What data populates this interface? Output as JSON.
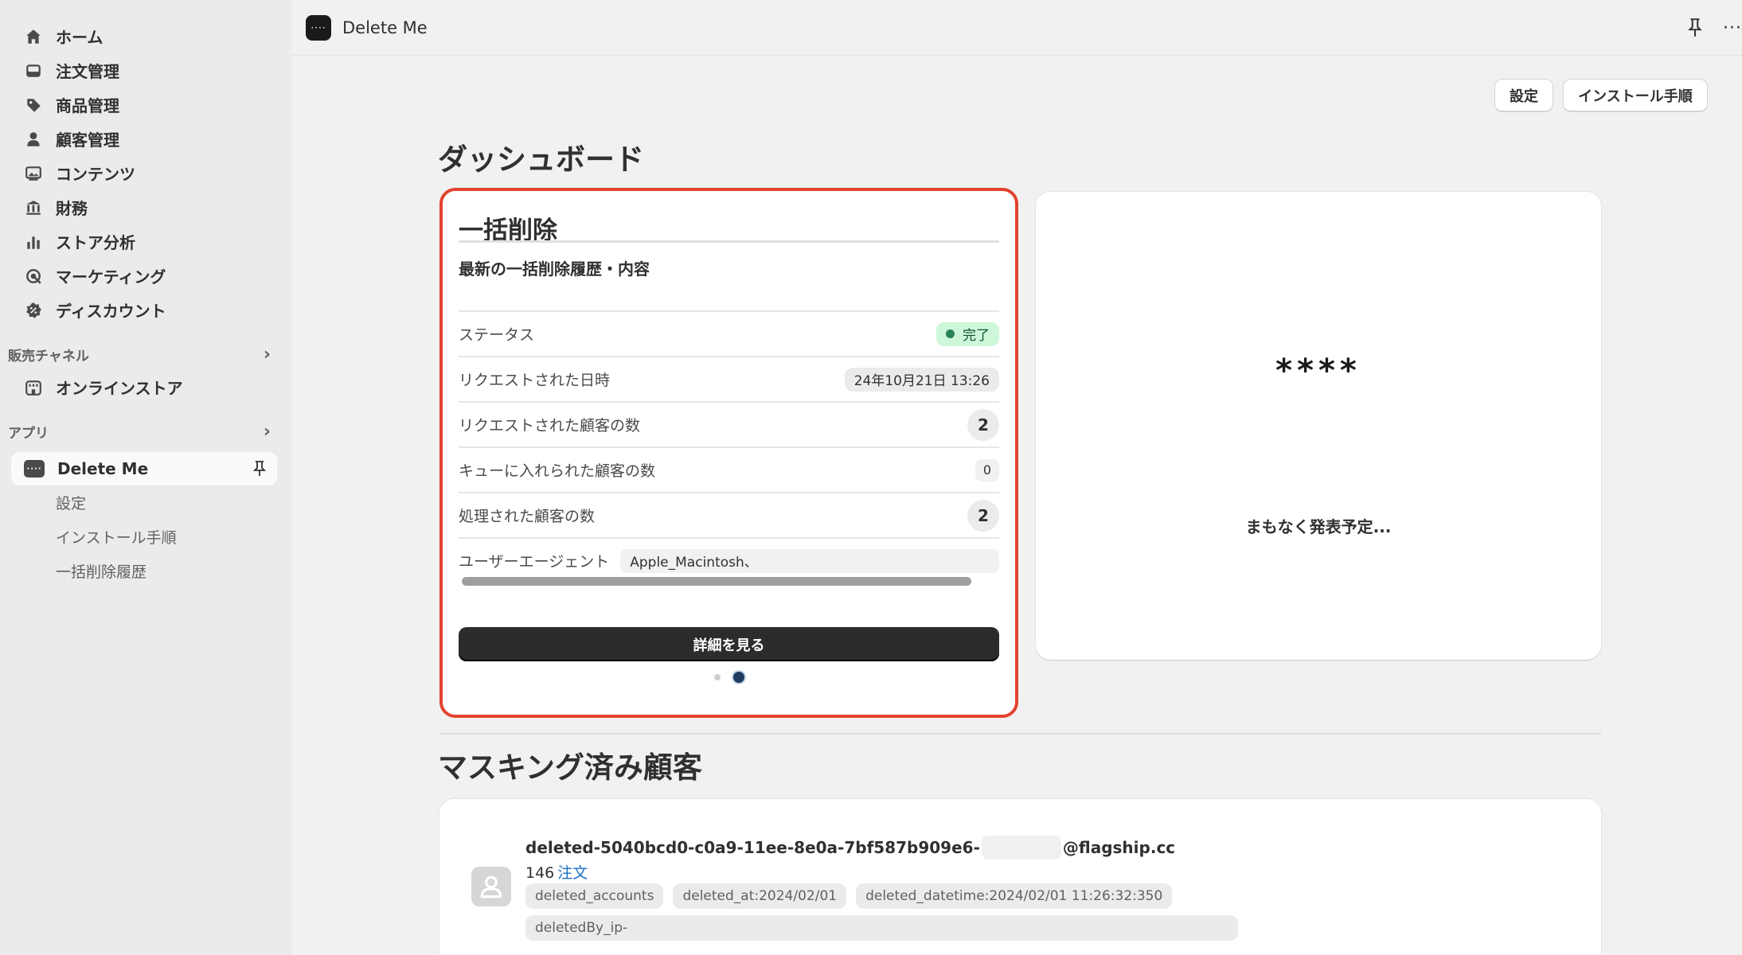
{
  "sidebar": {
    "items": [
      {
        "label": "ホーム",
        "icon": "home-icon"
      },
      {
        "label": "注文管理",
        "icon": "inbox-icon"
      },
      {
        "label": "商品管理",
        "icon": "tag-icon"
      },
      {
        "label": "顧客管理",
        "icon": "person-icon"
      },
      {
        "label": "コンテンツ",
        "icon": "image-icon"
      },
      {
        "label": "財務",
        "icon": "bank-icon"
      },
      {
        "label": "ストア分析",
        "icon": "bar-chart-icon"
      },
      {
        "label": "マーケティング",
        "icon": "target-icon"
      },
      {
        "label": "ディスカウント",
        "icon": "discount-icon"
      }
    ],
    "sales_channel_heading": "販売チャネル",
    "online_store": "オンラインストア",
    "apps_heading": "アプリ",
    "app_name": "Delete Me",
    "app_sub_items": [
      "設定",
      "インストール手順",
      "一括削除履歴"
    ]
  },
  "topbar": {
    "title": "Delete Me",
    "logo_glyph": "····",
    "more": "···"
  },
  "header": {
    "settings_button": "設定",
    "install_button": "インストール手順"
  },
  "dashboard": {
    "heading": "ダッシュボード"
  },
  "bulk_card": {
    "title": "一括削除",
    "subtitle": "最新の一括削除履歴・内容",
    "status_label": "ステータス",
    "status_value": "完了",
    "status_color": "#cdf7d8",
    "requested_at_label": "リクエストされた日時",
    "requested_at_value": "24年10月21日 13:26",
    "requested_customers_label": "リクエストされた顧客の数",
    "requested_customers_value": "2",
    "queued_customers_label": "キューに入れられた顧客の数",
    "queued_customers_value": "0",
    "processed_customers_label": "処理された顧客の数",
    "processed_customers_value": "2",
    "user_agent_label": "ユーザーエージェント",
    "user_agent_value": "Apple_Macintosh、",
    "detail_button": "詳細を見る",
    "pagination": {
      "pages": 2,
      "current": 2
    }
  },
  "coming_card": {
    "stars": "****",
    "message": "まもなく発表予定..."
  },
  "masked": {
    "heading": "マスキング済み顧客",
    "email_prefix": "deleted-5040bcd0-c0a9-11ee-8e0a-7bf587b909e6-",
    "email_suffix": "@flagship.cc",
    "order_count": "146",
    "order_label": "注文",
    "tags": [
      "deleted_accounts",
      "deleted_at:2024/02/01",
      "deleted_datetime:2024/02/01 11:26:32:350"
    ],
    "tag_long": "deletedBy_ip-"
  },
  "colors": {
    "highlight_border": "#e2432f",
    "primary_button": "#2c2c2c"
  }
}
